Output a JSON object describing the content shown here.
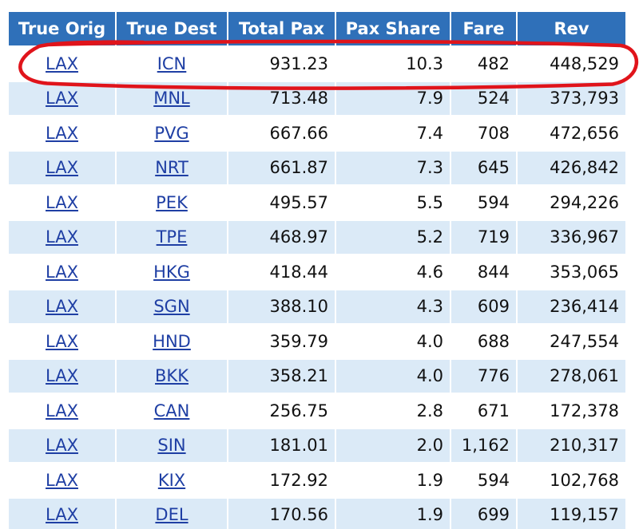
{
  "table": {
    "headers": [
      "True Orig",
      "True Dest",
      "Total Pax",
      "Pax Share",
      "Fare",
      "Rev"
    ],
    "rows": [
      {
        "orig": "LAX",
        "dest": "ICN",
        "pax": "931.23",
        "share": "10.3",
        "fare": "482",
        "rev": "448,529"
      },
      {
        "orig": "LAX",
        "dest": "MNL",
        "pax": "713.48",
        "share": "7.9",
        "fare": "524",
        "rev": "373,793"
      },
      {
        "orig": "LAX",
        "dest": "PVG",
        "pax": "667.66",
        "share": "7.4",
        "fare": "708",
        "rev": "472,656"
      },
      {
        "orig": "LAX",
        "dest": "NRT",
        "pax": "661.87",
        "share": "7.3",
        "fare": "645",
        "rev": "426,842"
      },
      {
        "orig": "LAX",
        "dest": "PEK",
        "pax": "495.57",
        "share": "5.5",
        "fare": "594",
        "rev": "294,226"
      },
      {
        "orig": "LAX",
        "dest": "TPE",
        "pax": "468.97",
        "share": "5.2",
        "fare": "719",
        "rev": "336,967"
      },
      {
        "orig": "LAX",
        "dest": "HKG",
        "pax": "418.44",
        "share": "4.6",
        "fare": "844",
        "rev": "353,065"
      },
      {
        "orig": "LAX",
        "dest": "SGN",
        "pax": "388.10",
        "share": "4.3",
        "fare": "609",
        "rev": "236,414"
      },
      {
        "orig": "LAX",
        "dest": "HND",
        "pax": "359.79",
        "share": "4.0",
        "fare": "688",
        "rev": "247,554"
      },
      {
        "orig": "LAX",
        "dest": "BKK",
        "pax": "358.21",
        "share": "4.0",
        "fare": "776",
        "rev": "278,061"
      },
      {
        "orig": "LAX",
        "dest": "CAN",
        "pax": "256.75",
        "share": "2.8",
        "fare": "671",
        "rev": "172,378"
      },
      {
        "orig": "LAX",
        "dest": "SIN",
        "pax": "181.01",
        "share": "2.0",
        "fare": "1,162",
        "rev": "210,317"
      },
      {
        "orig": "LAX",
        "dest": "KIX",
        "pax": "172.92",
        "share": "1.9",
        "fare": "594",
        "rev": "102,768"
      },
      {
        "orig": "LAX",
        "dest": "DEL",
        "pax": "170.56",
        "share": "1.9",
        "fare": "699",
        "rev": "119,157"
      }
    ]
  },
  "highlight": {
    "row_index": 0
  },
  "colors": {
    "header_bg": "#2f70b9",
    "row_alt_bg": "#dbeaf7",
    "link": "#1f3fa4",
    "highlight_ring": "#e0141b"
  }
}
